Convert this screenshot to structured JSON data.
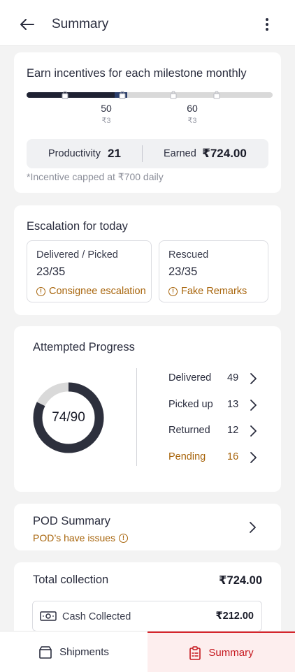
{
  "header": {
    "title": "Summary"
  },
  "incentive": {
    "title": "Earn incentives for each milestone monthly",
    "milestones": [
      {
        "value": "50",
        "reward": "₹3"
      },
      {
        "value": "60",
        "reward": "₹3"
      }
    ],
    "progress_fraction": 0.41,
    "productivity_label": "Productivity",
    "productivity_value": "21",
    "earned_label": "Earned",
    "earned_value": "₹724.00",
    "cap_note": "*Incentive capped at ₹700 daily"
  },
  "escalation": {
    "title": "Escalation for today",
    "boxes": [
      {
        "label": "Delivered / Picked",
        "value": "23/35",
        "warning": "Consignee escalation"
      },
      {
        "label": "Rescued",
        "value": "23/35",
        "warning": "Fake Remarks"
      }
    ]
  },
  "progress": {
    "title": "Attempted Progress",
    "donut_text": "74/90",
    "attempted": 74,
    "total": 90,
    "rows": [
      {
        "label": "Delivered",
        "count": "49"
      },
      {
        "label": "Picked up",
        "count": "13"
      },
      {
        "label": "Returned",
        "count": "12"
      },
      {
        "label": "Pending",
        "count": "16"
      }
    ]
  },
  "pod": {
    "title": "POD Summary",
    "subtitle": "POD’s have issues"
  },
  "collection": {
    "title": "Total collection",
    "total": "₹724.00",
    "cash_label": "Cash Collected",
    "cash_value": "₹212.00"
  },
  "nav": {
    "shipments": "Shipments",
    "summary": "Summary"
  },
  "colors": {
    "accent": "#c5161d",
    "warning": "#a8650c",
    "dark": "#1f2233"
  }
}
